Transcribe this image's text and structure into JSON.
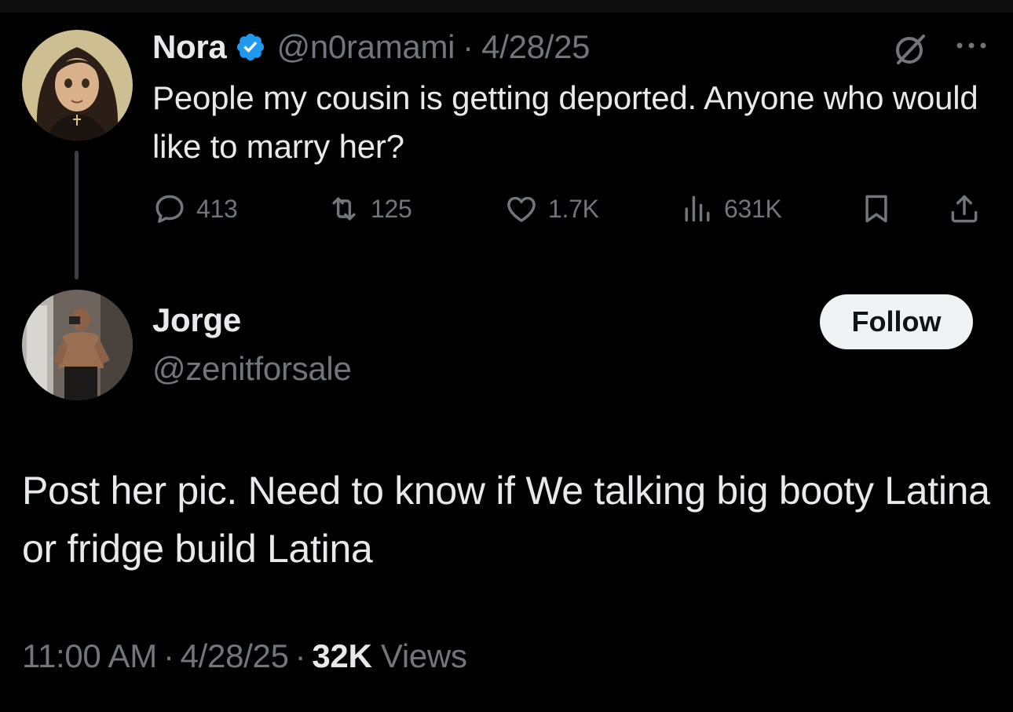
{
  "parent_tweet": {
    "author_name": "Nora",
    "handle": "@n0ramami",
    "separator": "·",
    "date": "4/28/25",
    "text": "People my cousin is getting deported. Anyone who would like to marry her?",
    "stats": {
      "replies": "413",
      "retweets": "125",
      "likes": "1.7K",
      "views": "631K"
    },
    "icons": [
      "verified-badge-icon",
      "grok-icon",
      "more-icon",
      "reply-icon",
      "retweet-icon",
      "like-icon",
      "views-icon",
      "bookmark-icon",
      "share-icon"
    ]
  },
  "reply_tweet": {
    "author_name": "Jorge",
    "handle": "@zenitforsale",
    "follow_label": "Follow",
    "text": "Post her pic. Need to know if We talking big booty Latina or fridge build Latina",
    "time": "11:00 AM",
    "separator": "·",
    "date": "4/28/25",
    "views_count": "32K",
    "views_label": "Views"
  },
  "colors": {
    "background": "#000000",
    "primary_text": "#e7e9ea",
    "secondary_text": "#71767b",
    "verified_blue": "#1d9bf0",
    "follow_button_bg": "#eff3f4",
    "thread_line": "#3e4144"
  }
}
